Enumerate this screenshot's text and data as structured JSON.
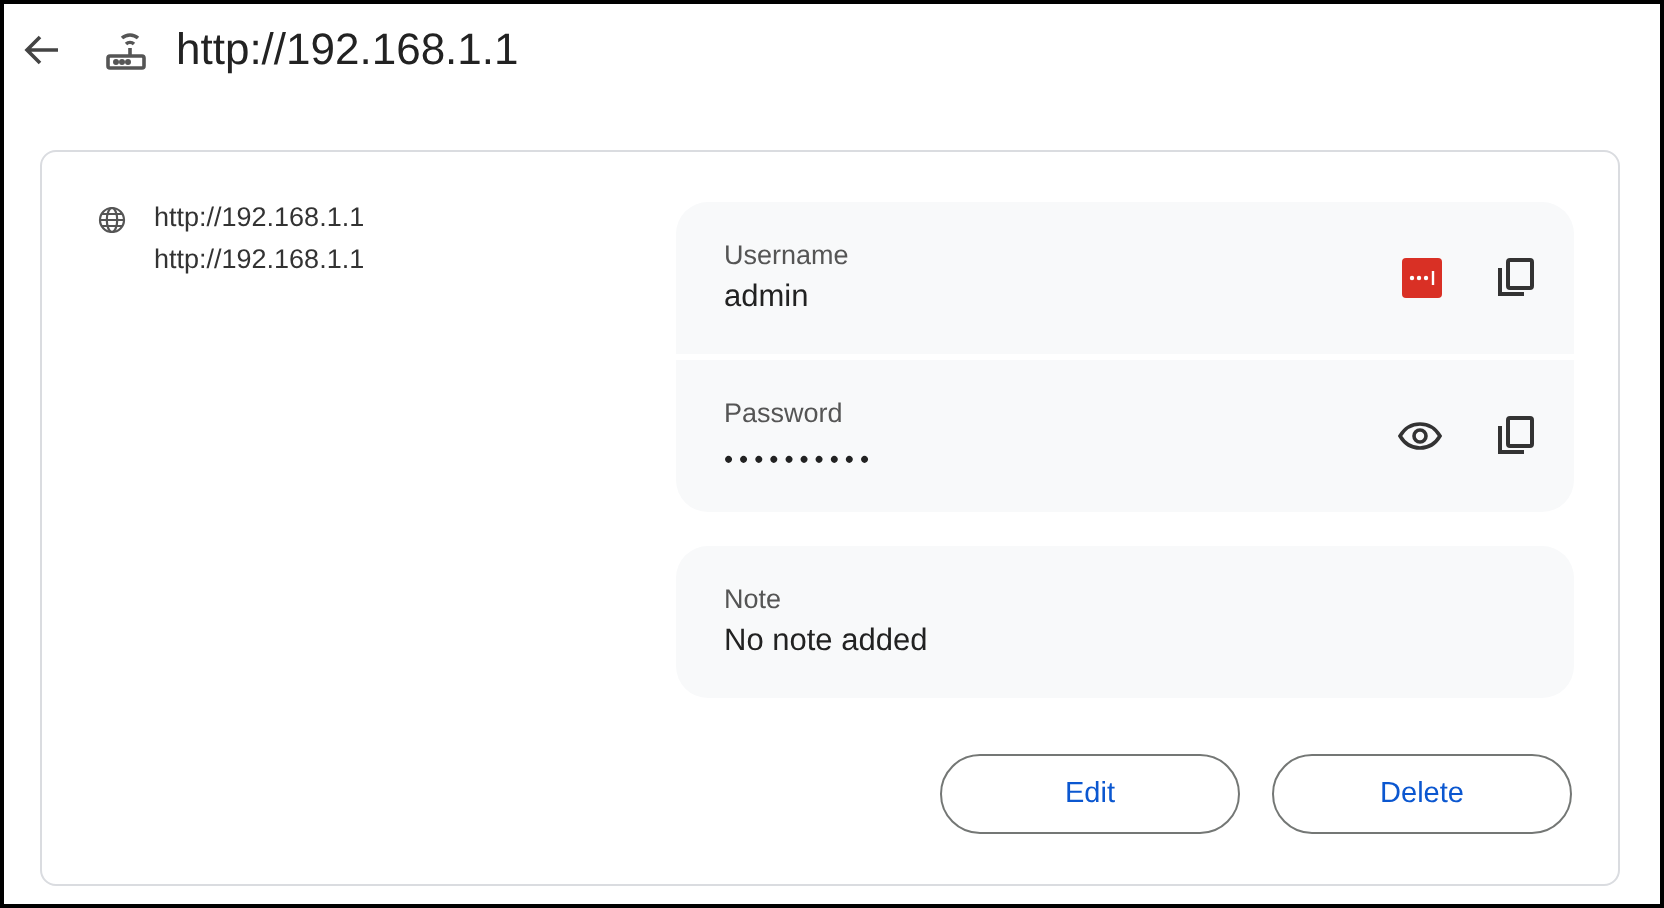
{
  "header": {
    "title": "http://192.168.1.1"
  },
  "sites": [
    "http://192.168.1.1",
    "http://192.168.1.1"
  ],
  "credentials": [
    {
      "kind": "username",
      "label": "Username",
      "value": "admin"
    },
    {
      "kind": "password",
      "label": "Password",
      "value": "••••••••••"
    }
  ],
  "note": {
    "label": "Note",
    "value": "No note added"
  },
  "buttons": [
    "Edit",
    "Delete"
  ]
}
